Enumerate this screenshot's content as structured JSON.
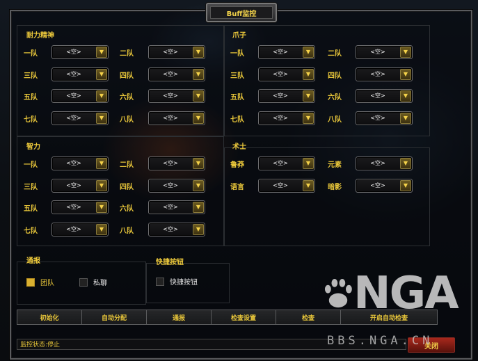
{
  "window": {
    "title": "Buff监控"
  },
  "empty_value": "<空>",
  "sections": {
    "stamina": {
      "label": "耐力精神",
      "rows": [
        "一队",
        "二队",
        "三队",
        "四队",
        "五队",
        "六队",
        "七队",
        "八队"
      ]
    },
    "claw": {
      "label": "爪子",
      "rows": [
        "一队",
        "二队",
        "三队",
        "四队",
        "五队",
        "六队",
        "七队",
        "八队"
      ]
    },
    "intellect": {
      "label": "智力",
      "rows": [
        "一队",
        "二队",
        "三队",
        "四队",
        "五队",
        "六队",
        "七队",
        "八队"
      ]
    },
    "warlock": {
      "label": "术士",
      "rows": [
        "鲁莽",
        "元素",
        "语言",
        "暗影"
      ]
    }
  },
  "report": {
    "label": "通报",
    "options": [
      {
        "label": "团队",
        "checked": true
      },
      {
        "label": "私聊",
        "checked": false
      }
    ]
  },
  "hotkey": {
    "label": "快捷按钮",
    "option": {
      "label": "快捷按钮",
      "checked": false
    }
  },
  "buttons": [
    "初始化",
    "自动分配",
    "通报",
    "检查设置",
    "检查",
    "开启自动检查"
  ],
  "status": {
    "text": "监控状态:停止"
  },
  "close_label": "关闭",
  "watermark": {
    "logo": "NGA",
    "url": "BBS.NGA.CN"
  }
}
